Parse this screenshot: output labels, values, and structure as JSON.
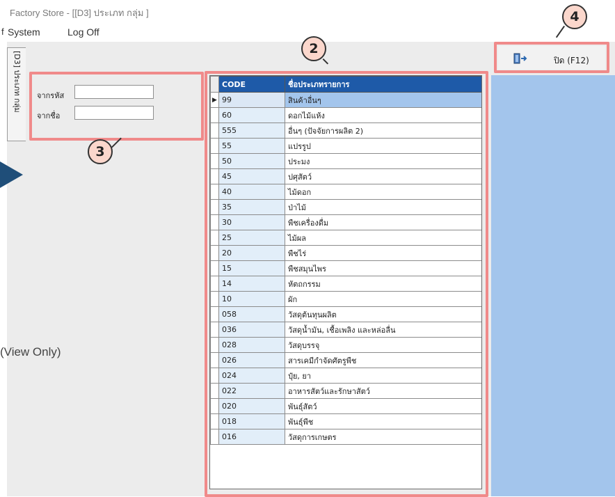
{
  "window": {
    "title": "Factory Store - [[D3] ประเภท กลุ่ม ]"
  },
  "menu": {
    "mark": "f",
    "items": [
      "System",
      "Log Off"
    ]
  },
  "tab": {
    "label": "[D3] ประเภท กลุ่ม"
  },
  "filters": {
    "from_code_label": "จากรหัส",
    "from_code_value": "",
    "from_name_label": "จากชื่อ",
    "from_name_value": ""
  },
  "toolbar": {
    "close_label": "ปิด (F12)",
    "close_icon": "exit-door-icon"
  },
  "grid": {
    "columns": [
      "CODE",
      "ชื่อประเภทรายการ"
    ],
    "selected_indicator": "▶",
    "rows": [
      {
        "code": "99",
        "name": "สินค้าอื่นๆ"
      },
      {
        "code": "60",
        "name": "ดอกไม้แห้ง"
      },
      {
        "code": "555",
        "name": "อื่นๆ (ปัจจัยการผลิต 2)"
      },
      {
        "code": "55",
        "name": "แปรรูป"
      },
      {
        "code": "50",
        "name": "ประมง"
      },
      {
        "code": "45",
        "name": "ปศุสัตว์"
      },
      {
        "code": "40",
        "name": "ไม้ดอก"
      },
      {
        "code": "35",
        "name": "ป่าไม้"
      },
      {
        "code": "30",
        "name": "พืชเครื่องดื่ม"
      },
      {
        "code": "25",
        "name": "ไม้ผล"
      },
      {
        "code": "20",
        "name": "พืชไร่"
      },
      {
        "code": "15",
        "name": "พืชสมุนไพร"
      },
      {
        "code": "14",
        "name": "หัตถกรรม"
      },
      {
        "code": "10",
        "name": "ผัก"
      },
      {
        "code": "058",
        "name": "วัสดุต้นทุนผลิต"
      },
      {
        "code": "036",
        "name": "วัสดุน้ำมัน, เชื้อเพลิง และหล่อลื่น"
      },
      {
        "code": "028",
        "name": "วัสดุบรรจุ"
      },
      {
        "code": "026",
        "name": "สารเคมีกำจัดศัตรูพืช"
      },
      {
        "code": "024",
        "name": "ปุ๋ย, ยา"
      },
      {
        "code": "022",
        "name": "อาหารสัตว์และรักษาสัตว์"
      },
      {
        "code": "020",
        "name": "พันธุ์สัตว์"
      },
      {
        "code": "018",
        "name": "พันธุ์พืช"
      },
      {
        "code": "016",
        "name": "วัสดุการเกษตร"
      }
    ]
  },
  "annotations": {
    "badge_2": "2",
    "badge_3": "3",
    "badge_4": "4",
    "view_only": "(View Only)"
  },
  "colors": {
    "header": "#1e5aa8",
    "selection": "#a3c5ec",
    "highlight": "#f08a8a",
    "badge_fill": "#fbd7cc"
  }
}
